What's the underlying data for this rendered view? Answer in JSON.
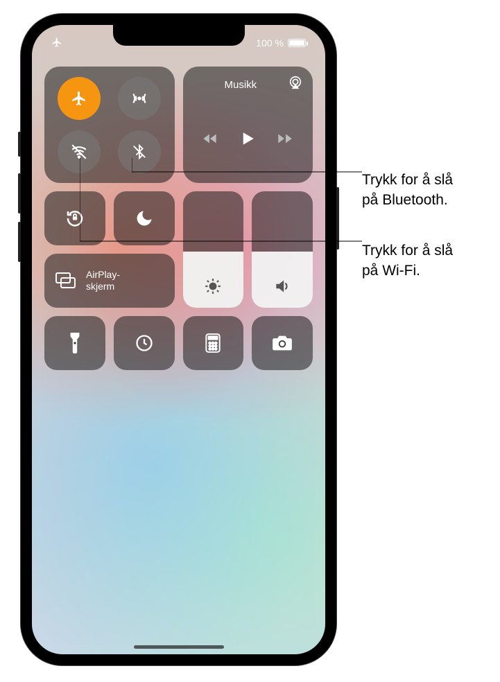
{
  "status": {
    "battery_text": "100 %"
  },
  "connectivity": {
    "airplane_active": true
  },
  "media": {
    "title": "Musikk"
  },
  "airplay": {
    "label": "AirPlay-\nskjerm"
  },
  "sliders": {
    "brightness_pct": 48,
    "volume_pct": 48
  },
  "callouts": {
    "bluetooth": "Trykk for å slå\npå Bluetooth.",
    "wifi": "Trykk for å slå\npå Wi-Fi."
  }
}
